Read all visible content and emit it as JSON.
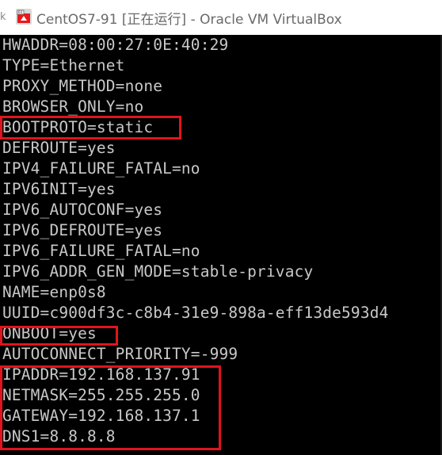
{
  "window": {
    "title": "CentOS7-91 [正在运行] - Oracle VM VirtualBox",
    "icon": "virtualbox-icon",
    "left_edge_char": "k"
  },
  "console": {
    "lines": [
      "HWADDR=08:00:27:0E:40:29",
      "TYPE=Ethernet",
      "PROXY_METHOD=none",
      "BROWSER_ONLY=no",
      "BOOTPROTO=static",
      "DEFROUTE=yes",
      "IPV4_FAILURE_FATAL=no",
      "IPV6INIT=yes",
      "IPV6_AUTOCONF=yes",
      "IPV6_DEFROUTE=yes",
      "IPV6_FAILURE_FATAL=no",
      "IPV6_ADDR_GEN_MODE=stable-privacy",
      "NAME=enp0s8",
      "UUID=c900df3c-c8b4-31e9-898a-eff13de593d4",
      "ONBOOT=yes",
      "AUTOCONNECT_PRIORITY=-999",
      "IPADDR=192.168.137.91",
      "NETMASK=255.255.255.0",
      "GATEWAY=192.168.137.1",
      "DNS1=8.8.8.8"
    ],
    "highlight_color": "#e0141c",
    "text_color": "#c8c8c8",
    "background": "#000000"
  }
}
